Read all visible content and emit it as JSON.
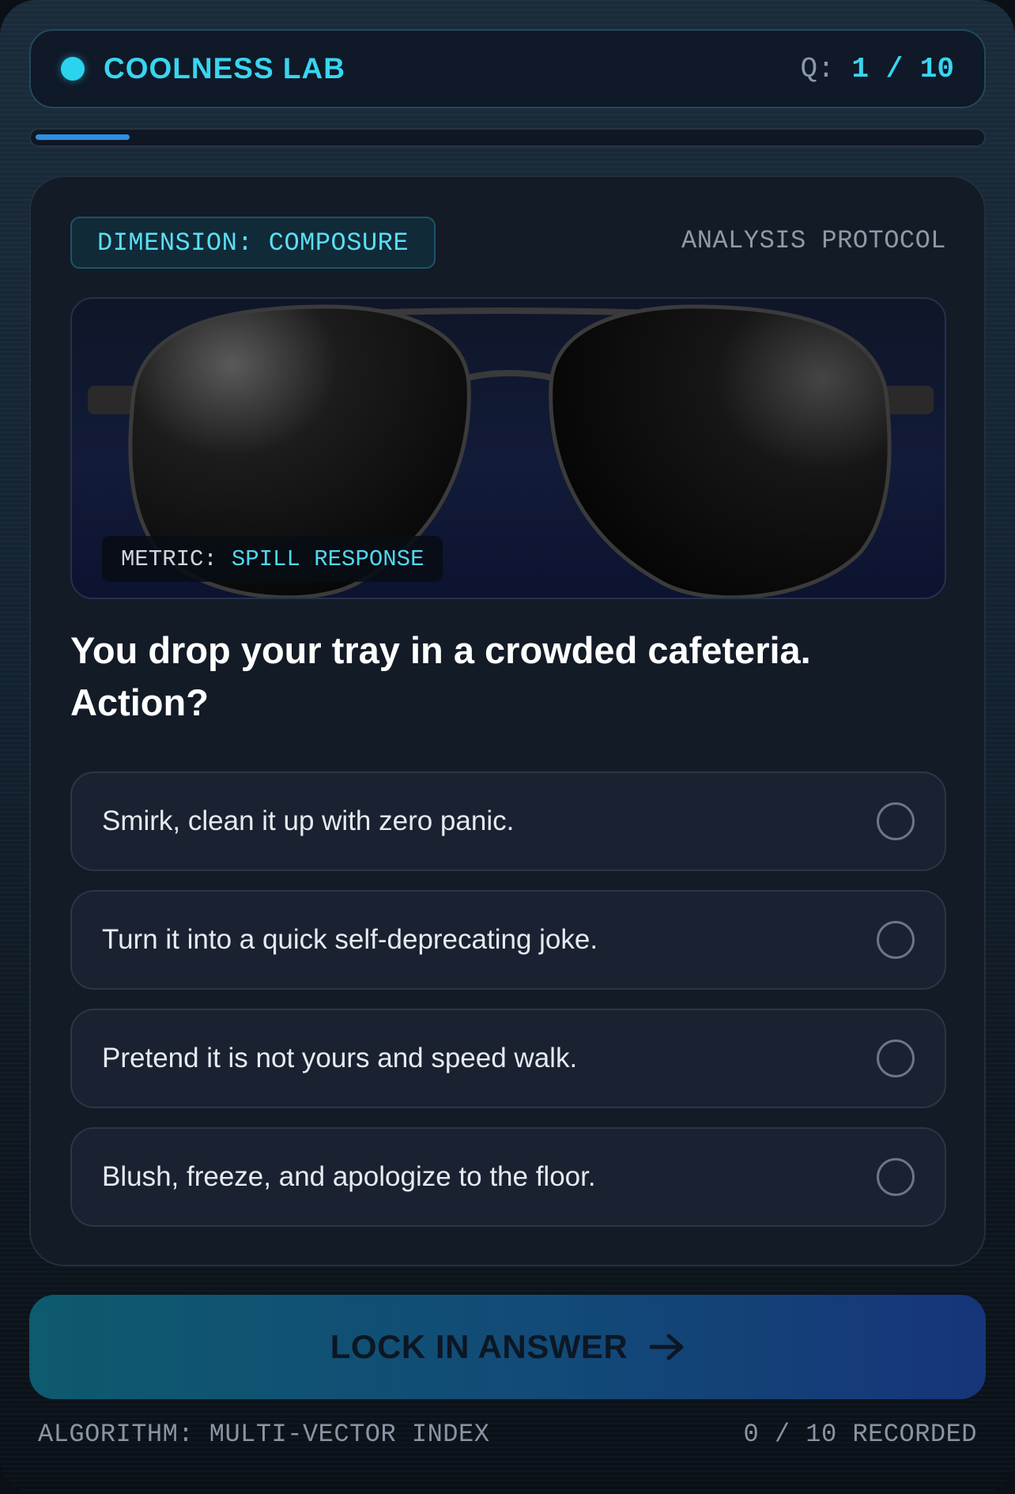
{
  "header": {
    "brand": "COOLNESS LAB",
    "question_label": "Q:",
    "question_counter": "1 / 10"
  },
  "progress": {
    "fraction": 0.1
  },
  "card": {
    "dimension_tag": "DIMENSION: COMPOSURE",
    "protocol_label": "ANALYSIS PROTOCOL",
    "image": {
      "icon": "aviator-sunglasses",
      "metric_label": "METRIC:",
      "metric_value": "SPILL RESPONSE"
    },
    "question": "You drop your tray in a crowded cafeteria. Action?",
    "options": [
      {
        "label": "Smirk, clean it up with zero panic.",
        "selected": false
      },
      {
        "label": "Turn it into a quick self-deprecating joke.",
        "selected": false
      },
      {
        "label": "Pretend it is not yours and speed walk.",
        "selected": false
      },
      {
        "label": "Blush, freeze, and apologize to the floor.",
        "selected": false
      }
    ]
  },
  "cta": {
    "label": "LOCK IN ANSWER",
    "icon": "arrow-right-icon"
  },
  "footer": {
    "algorithm": "ALGORITHM: MULTI-VECTOR INDEX",
    "recorded": "0 / 10 RECORDED"
  },
  "colors": {
    "accent": "#38d5f0",
    "cta_start": "#0e5a6e",
    "cta_end": "#163579",
    "card_bg": "#131b27"
  }
}
